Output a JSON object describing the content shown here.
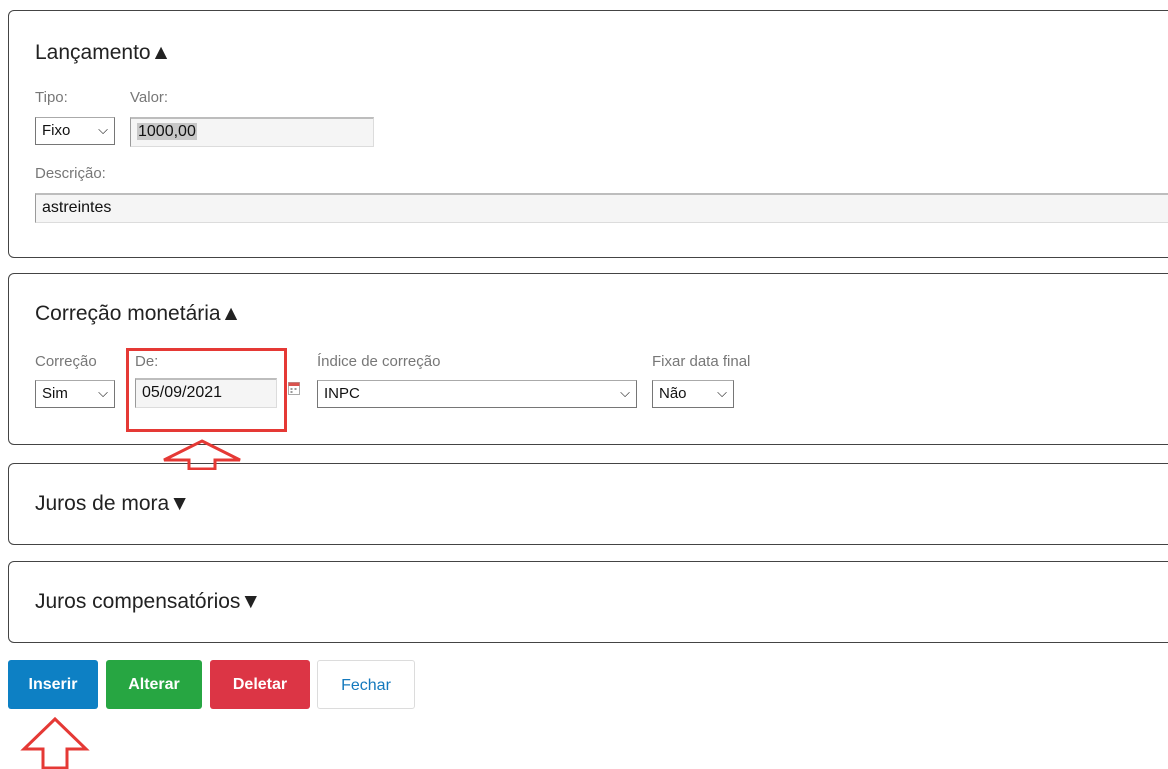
{
  "lancamento": {
    "title": "Lançamento▲",
    "tipo_label": "Tipo:",
    "tipo_value": "Fixo",
    "valor_label": "Valor:",
    "valor_value": "1000,00",
    "descricao_label": "Descrição:",
    "descricao_value": "astreintes"
  },
  "correcao": {
    "title": "Correção monetária▲",
    "correcao_label": "Correção",
    "correcao_value": "Sim",
    "de_label": "De:",
    "de_value": "05/09/2021",
    "indice_label": "Índice de correção",
    "indice_value": "INPC",
    "fixar_label": "Fixar data final",
    "fixar_value": "Não"
  },
  "juros_mora": {
    "title": "Juros de mora▼"
  },
  "juros_comp": {
    "title": "Juros compensatórios▼"
  },
  "buttons": {
    "inserir": "Inserir",
    "alterar": "Alterar",
    "deletar": "Deletar",
    "fechar": "Fechar"
  },
  "colors": {
    "primary": "#0d80c4",
    "success": "#27a642",
    "danger": "#dc3545",
    "annotation": "#e53935"
  },
  "icons": {
    "dropdown": "chevron-down-icon",
    "calendar": "calendar-icon",
    "annotation_arrow": "up-arrow-annotation-icon"
  }
}
